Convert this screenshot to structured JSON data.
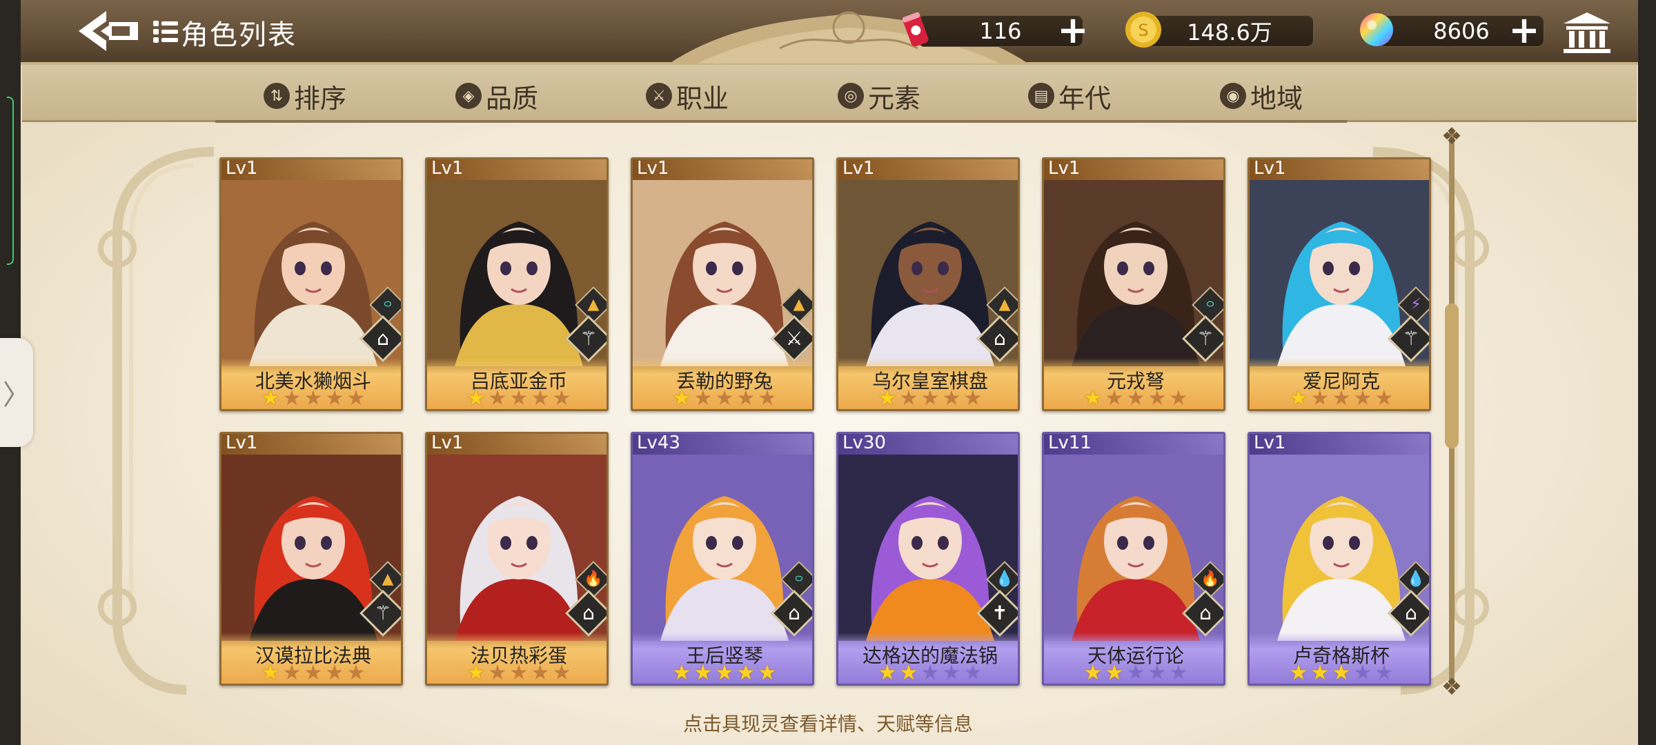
{
  "header": {
    "title": "角色列表",
    "resources": [
      {
        "name": "stamina",
        "icon": "soda-can-icon",
        "value": "116"
      },
      {
        "name": "gold",
        "icon": "gold-coin-icon",
        "value": "148.6万"
      },
      {
        "name": "gem",
        "icon": "rainbow-gem-icon",
        "value": "8606"
      }
    ]
  },
  "filters": [
    {
      "label": "排序",
      "icon": "sort-icon"
    },
    {
      "label": "品质",
      "icon": "quality-icon"
    },
    {
      "label": "职业",
      "icon": "class-icon"
    },
    {
      "label": "元素",
      "icon": "element-icon"
    },
    {
      "label": "年代",
      "icon": "era-icon"
    },
    {
      "label": "地域",
      "icon": "region-icon"
    }
  ],
  "characters": [
    {
      "level": "Lv1",
      "name": "北美水獭烟斗",
      "stars": 1,
      "max_stars": 5,
      "rarity": "gold",
      "element": "wind",
      "job": "book",
      "palette": {
        "hair": "#7b4a2c",
        "skin": "#f2cfb6",
        "bg": "#a56b3a",
        "cloth": "#efe3d2"
      }
    },
    {
      "level": "Lv1",
      "name": "吕底亚金币",
      "stars": 1,
      "max_stars": 5,
      "rarity": "gold",
      "element": "earth",
      "job": "bow",
      "palette": {
        "hair": "#1f1a1c",
        "skin": "#f3d5c2",
        "bg": "#7d5a30",
        "cloth": "#e1b847"
      }
    },
    {
      "level": "Lv1",
      "name": "丢勒的野兔",
      "stars": 1,
      "max_stars": 5,
      "rarity": "gold",
      "element": "earth",
      "job": "swords",
      "palette": {
        "hair": "#8a4b2f",
        "skin": "#f4d9c6",
        "bg": "#d5b28a",
        "cloth": "#f6efe8"
      }
    },
    {
      "level": "Lv1",
      "name": "乌尔皇室棋盘",
      "stars": 1,
      "max_stars": 5,
      "rarity": "gold",
      "element": "earth",
      "job": "book",
      "palette": {
        "hair": "#1b1d2c",
        "skin": "#8b5a3c",
        "bg": "#6f5637",
        "cloth": "#e8e4f0"
      }
    },
    {
      "level": "Lv1",
      "name": "元戎弩",
      "stars": 1,
      "max_stars": 5,
      "rarity": "gold",
      "element": "wind",
      "job": "bow",
      "palette": {
        "hair": "#3a2419",
        "skin": "#f1d3bd",
        "bg": "#5a3b2a",
        "cloth": "#2b2120"
      }
    },
    {
      "level": "Lv1",
      "name": "爱尼阿克",
      "stars": 1,
      "max_stars": 5,
      "rarity": "gold",
      "element": "thunder",
      "job": "bow",
      "palette": {
        "hair": "#2fb6e3",
        "skin": "#f4dccd",
        "bg": "#3c4257",
        "cloth": "#f1f1f5"
      }
    },
    {
      "level": "Lv1",
      "name": "汉谟拉比法典",
      "stars": 1,
      "max_stars": 5,
      "rarity": "gold",
      "element": "earth",
      "job": "bow",
      "palette": {
        "hair": "#d8321d",
        "skin": "#f4d2c0",
        "bg": "#6e3422",
        "cloth": "#1f1b1b"
      }
    },
    {
      "level": "Lv1",
      "name": "法贝热彩蛋",
      "stars": 1,
      "max_stars": 5,
      "rarity": "gold",
      "element": "fire",
      "job": "book",
      "palette": {
        "hair": "#e9e4ea",
        "skin": "#f6ddcf",
        "bg": "#8a3b2a",
        "cloth": "#b3201e"
      }
    },
    {
      "level": "Lv43",
      "name": "王后竖琴",
      "stars": 5,
      "max_stars": 5,
      "rarity": "purple",
      "element": "wind",
      "job": "book",
      "palette": {
        "hair": "#f2a23a",
        "skin": "#f7dfcf",
        "bg": "#7862b7",
        "cloth": "#e6e0ef"
      }
    },
    {
      "level": "Lv30",
      "name": "达格达的魔法锅",
      "stars": 2,
      "max_stars": 5,
      "rarity": "purple",
      "element": "water",
      "job": "cross",
      "palette": {
        "hair": "#9c5bd6",
        "skin": "#f5dccd",
        "bg": "#2d2848",
        "cloth": "#f08a1f"
      }
    },
    {
      "level": "Lv11",
      "name": "天体运行论",
      "stars": 2,
      "max_stars": 5,
      "rarity": "purple",
      "element": "fire",
      "job": "book",
      "palette": {
        "hair": "#d77c35",
        "skin": "#f5dacb",
        "bg": "#7b66b8",
        "cloth": "#c8232a"
      }
    },
    {
      "level": "Lv1",
      "name": "卢奇格斯杯",
      "stars": 3,
      "max_stars": 5,
      "rarity": "purple",
      "element": "water",
      "job": "book",
      "palette": {
        "hair": "#f0c23a",
        "skin": "#f7dfd0",
        "bg": "#8a78c8",
        "cloth": "#f4f1f4"
      }
    }
  ],
  "footer_hint": "点击具现灵查看详情、天赋等信息",
  "colors": {
    "gold_card": "#c7955a",
    "purple_card": "#8d79c9",
    "header_bg": "#6b5540",
    "star_on": "#ffd21f"
  }
}
